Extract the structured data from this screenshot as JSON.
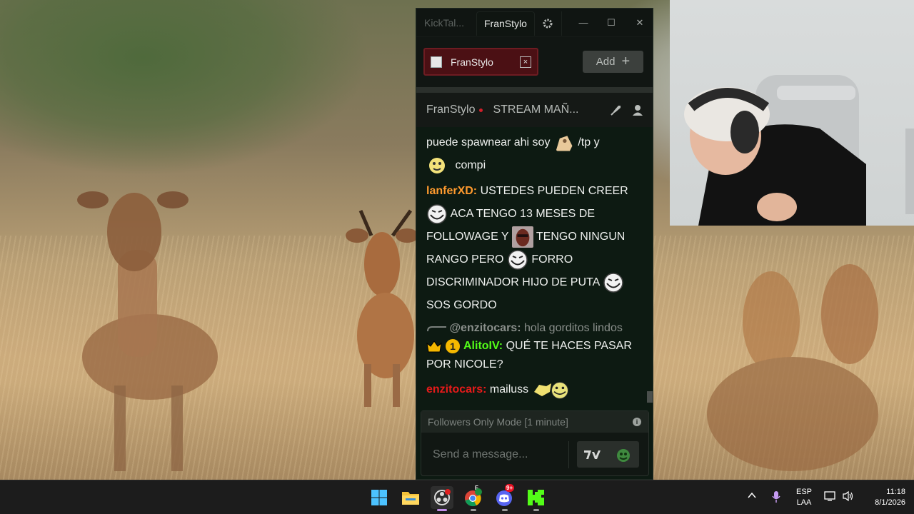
{
  "window": {
    "app_title": "KickTal...",
    "active_tab": "FranStylo",
    "controls": {
      "minimize": "—",
      "maximize": "☐",
      "close": "✕"
    }
  },
  "channel_tab": {
    "name": "FranStylo",
    "close": "×"
  },
  "add_button": {
    "label": "Add",
    "icon": "+"
  },
  "channel_bar": {
    "channel": "FranStylo",
    "stream_title": "STREAM MAÑ..."
  },
  "messages": [
    {
      "text": "puede spawnear ahi soy",
      "after": "/tp y"
    },
    {
      "text": "compi"
    },
    {
      "user": "lanferXD:",
      "user_color": "#ff9a2e",
      "lines": [
        "USTEDES PUEDEN CREER",
        "ACA TENGO 13 MESES DE",
        "FOLLOWAGE Y",
        "TENGO NINGUN",
        "RANGO PERO",
        "FORRO",
        "DISCRIMINADOR HIJO DE PUTA",
        "SOS GORDO"
      ]
    },
    {
      "reply_to": "@enzitocars:",
      "reply_text": "hola gorditos lindos"
    },
    {
      "user": "AlitoIV:",
      "user_color": "#53fc18",
      "lines": [
        "QUÉ TE HACES PASAR",
        "POR NICOLE?"
      ]
    },
    {
      "user": "enzitocars:",
      "user_color": "#e81a1a",
      "text": "mailuss"
    }
  ],
  "input": {
    "mode_notice": "Followers Only Mode [1 minute]",
    "placeholder": "Send a message..."
  },
  "taskbar": {
    "language": "ESP",
    "layout": "LAA",
    "time": "11:18",
    "date": "8/1/2026",
    "discord_badge": "9+",
    "chrome_badge": "F"
  },
  "colors": {
    "accent": "#53fc18",
    "live": "#d11f2a",
    "chat_bg": "#0d1a12"
  }
}
